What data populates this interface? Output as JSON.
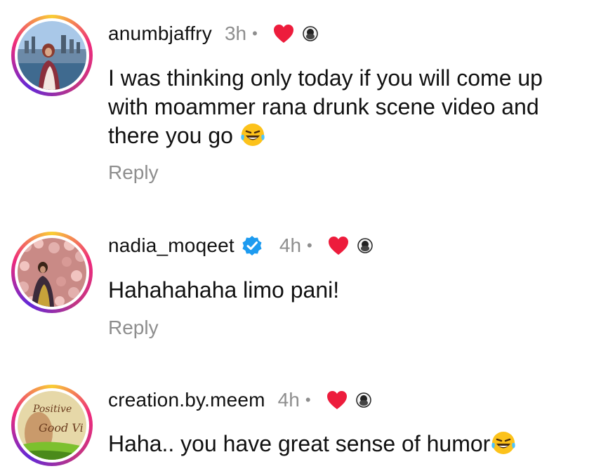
{
  "comments": [
    {
      "username": "anumbjaffry",
      "time": "3h",
      "dot": "•",
      "text_lines": [
        "I was thinking only today if you will come up",
        "with moammer rana drunk scene video and",
        "there you go"
      ],
      "emoji": "laughing-tears",
      "reply": "Reply",
      "verified": false
    },
    {
      "username": "nadia_moqeet",
      "time": "4h",
      "dot": "•",
      "text_lines": [
        "Hahahahaha limo pani!"
      ],
      "reply": "Reply",
      "verified": true
    },
    {
      "username": "creation.by.meem",
      "time": "4h",
      "dot": "•",
      "text_lines": [
        "Haha.. you have great sense of humor"
      ],
      "emoji": "laughing-tears",
      "verified": false
    }
  ],
  "avatar3_lettering": [
    "Positive",
    "Good Vi"
  ],
  "colors": {
    "heart": "#ed1c3c",
    "verified": "#1d9bf0",
    "muted": "#8e8e8e"
  }
}
